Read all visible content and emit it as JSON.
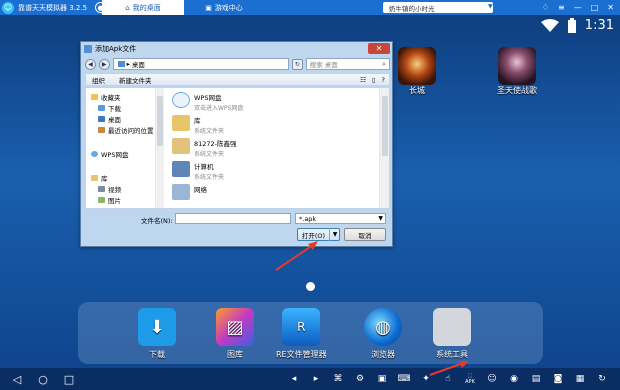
{
  "titlebar": {
    "app_title": "靠谱天天模拟器 3.2.5",
    "tabs": [
      "我的桌面",
      "游戏中心"
    ],
    "ticker": "奶牛镇的小时光"
  },
  "status": {
    "time": "1:31"
  },
  "home_apps": [
    "长城",
    "圣天使战歌"
  ],
  "dock": [
    "下载",
    "图库",
    "RE文件管理器",
    "浏览器",
    "系统工具"
  ],
  "dialog": {
    "title": "添加Apk文件",
    "address": "桌面",
    "search_placeholder": "搜索 桌面",
    "toolbar": [
      "组织",
      "新建文件夹"
    ],
    "nav_items": [
      "收藏夹",
      "下载",
      "桌面",
      "最近访问的位置",
      "WPS网盘",
      "库",
      "视频",
      "图片"
    ],
    "files": [
      {
        "name": "WPS网盘",
        "sub": "双击进入WPS网盘"
      },
      {
        "name": "库",
        "sub": "系统文件夹"
      },
      {
        "name": "81272-陈鑫强",
        "sub": "系统文件夹"
      },
      {
        "name": "计算机",
        "sub": "系统文件夹"
      },
      {
        "name": "网络",
        "sub": ""
      }
    ],
    "filename_label": "文件名(N):",
    "filename_value": "",
    "filetype": "*.apk",
    "open_label": "打开(O)",
    "cancel_label": "取消"
  },
  "navbar": {
    "apk_label": "APK"
  },
  "colors": {
    "titlebar": "#1b6fd1",
    "annotation_arrow": "#e23b2e"
  }
}
